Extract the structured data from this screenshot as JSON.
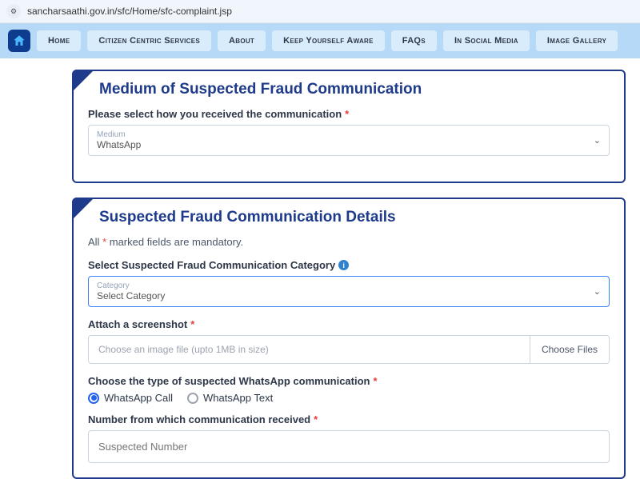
{
  "url": "sancharsaathi.gov.in/sfc/Home/sfc-complaint.jsp",
  "nav": {
    "items": [
      "Home",
      "Citizen Centric Services",
      "About",
      "Keep Yourself Aware",
      "FAQs",
      "In Social Media",
      "Image Gallery"
    ]
  },
  "panel1": {
    "title": "Medium of Suspected Fraud Communication",
    "prompt": "Please select how you received the communication",
    "select_label": "Medium",
    "select_value": "WhatsApp"
  },
  "panel2": {
    "title": "Suspected Fraud Communication Details",
    "mandatory_prefix": "All ",
    "mandatory_suffix": " marked fields are mandatory.",
    "cat_label": "Select Suspected Fraud Communication Category",
    "cat_select_label": "Category",
    "cat_select_value": "Select Category",
    "attach_label": "Attach a screenshot",
    "file_placeholder": "Choose an image file (upto 1MB in size)",
    "file_btn": "Choose Files",
    "type_label": "Choose the type of suspected WhatsApp communication",
    "radio1": "WhatsApp Call",
    "radio2": "WhatsApp Text",
    "number_label": "Number from which communication received",
    "number_placeholder": "Suspected Number"
  }
}
